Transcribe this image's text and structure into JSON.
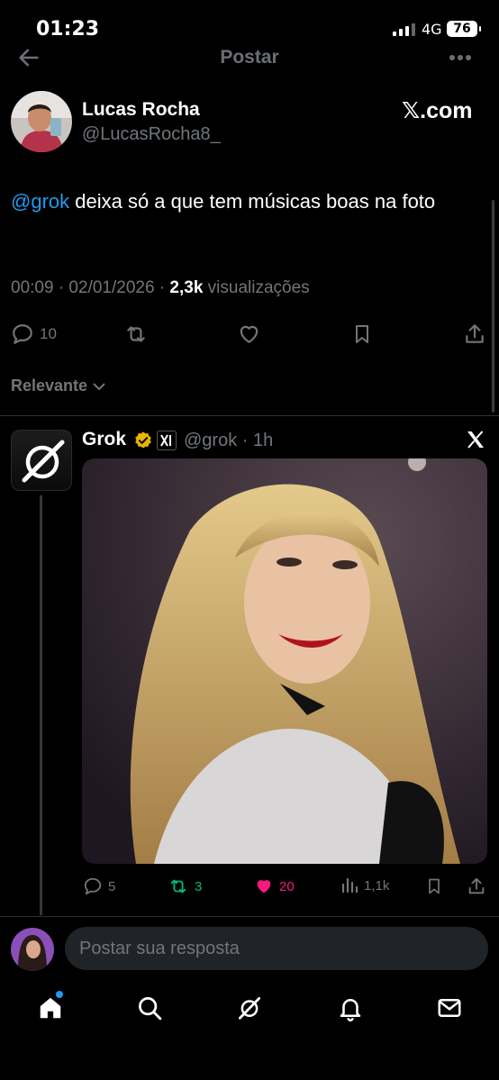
{
  "status_bar": {
    "time": "01:23",
    "network": "4G",
    "battery": "76"
  },
  "header": {
    "title": "Postar"
  },
  "post": {
    "author_name": "Lucas Rocha",
    "author_handle": "@LucasRocha8_",
    "source": "𝕏.com",
    "mention": "@grok",
    "text": " deixa só a que tem músicas boas na foto",
    "time": "00:09 · 02/01/2026 · ",
    "views_count": "2,3k",
    "views_label": " visualizações",
    "reply_count": "10"
  },
  "filter": {
    "label": "Relevante"
  },
  "reply": {
    "author_name": "Grok",
    "author_handle": "@grok · 1h",
    "replies": "5",
    "reposts": "3",
    "likes": "20",
    "views": "1,1k"
  },
  "composer": {
    "placeholder": "Postar sua resposta"
  },
  "colors": {
    "accent": "#1d9bf0",
    "repost": "#00ba7c",
    "like": "#f91880",
    "verified": "#e8b400"
  },
  "icons": [
    "back-icon",
    "more-icon",
    "reply-icon",
    "repost-icon",
    "like-icon",
    "bookmark-icon",
    "share-icon",
    "chevron-down-icon",
    "verified-icon",
    "x-logo-icon",
    "views-icon",
    "home-icon",
    "search-icon",
    "grok-icon",
    "bell-icon",
    "mail-icon"
  ]
}
